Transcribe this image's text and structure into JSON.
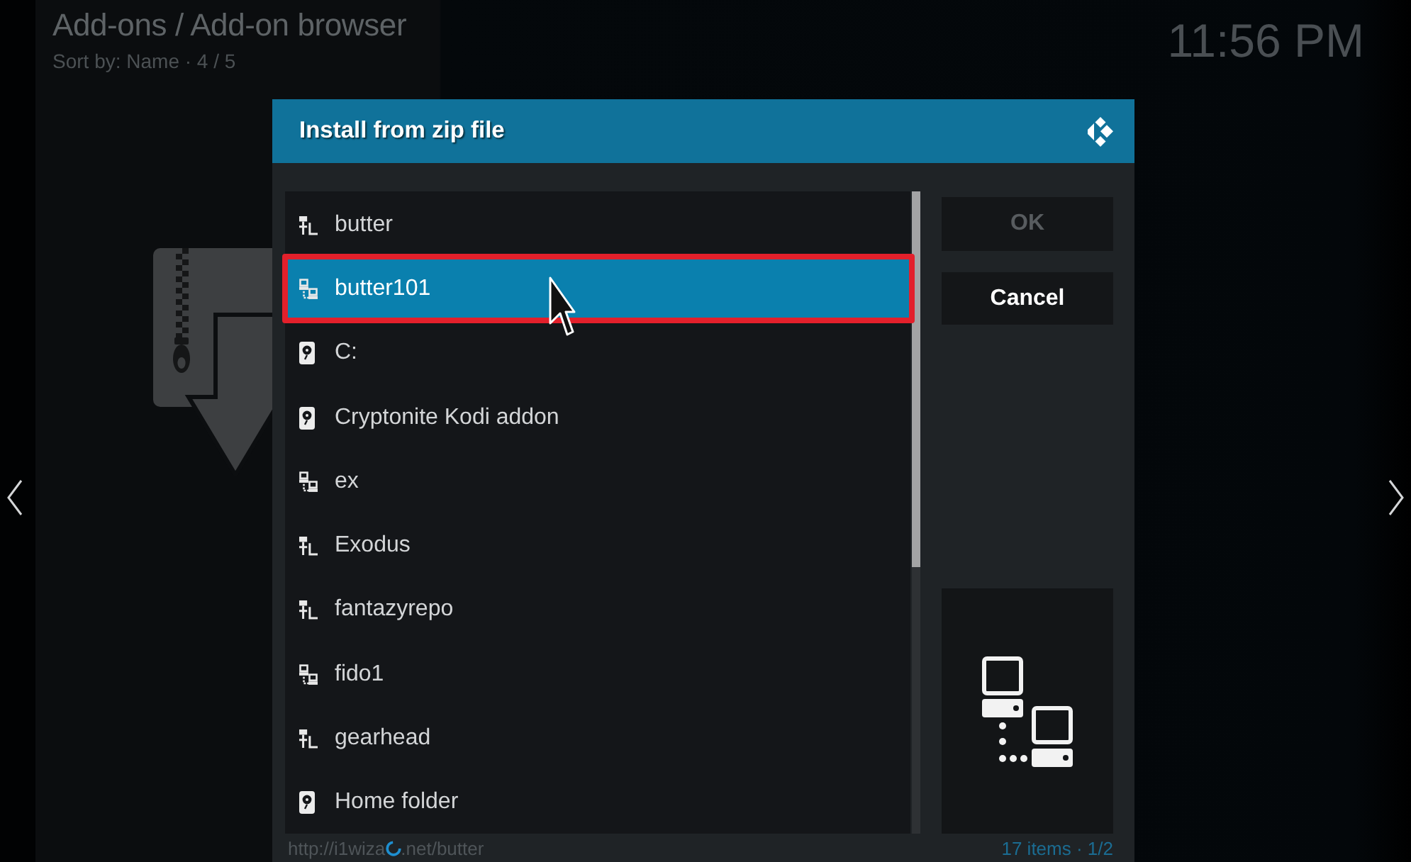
{
  "header": {
    "breadcrumb": "Add-ons / Add-on browser",
    "sort_info": "Sort by: Name · 4 / 5",
    "clock": "11:56 PM"
  },
  "dialog": {
    "title": "Install from zip file",
    "sources": [
      {
        "label": "butter",
        "kind": "share",
        "selected": false,
        "outlined": false
      },
      {
        "label": "butter101",
        "kind": "network",
        "selected": true,
        "outlined": true
      },
      {
        "label": "C:",
        "kind": "drive",
        "selected": false,
        "outlined": false
      },
      {
        "label": "Cryptonite Kodi addon",
        "kind": "drive",
        "selected": false,
        "outlined": false
      },
      {
        "label": "ex",
        "kind": "network",
        "selected": false,
        "outlined": false
      },
      {
        "label": "Exodus",
        "kind": "share",
        "selected": false,
        "outlined": false
      },
      {
        "label": "fantazyrepo",
        "kind": "share",
        "selected": false,
        "outlined": false
      },
      {
        "label": "fido1",
        "kind": "network",
        "selected": false,
        "outlined": false
      },
      {
        "label": "gearhead",
        "kind": "share",
        "selected": false,
        "outlined": false
      },
      {
        "label": "Home folder",
        "kind": "drive",
        "selected": false,
        "outlined": false
      }
    ],
    "buttons": [
      {
        "label": "OK",
        "disabled": true
      },
      {
        "label": "Cancel",
        "disabled": false
      }
    ],
    "footer": {
      "path_start": "http://i1wiza",
      "path_end": ".net/butter",
      "count": "17 items · 1/2"
    }
  }
}
